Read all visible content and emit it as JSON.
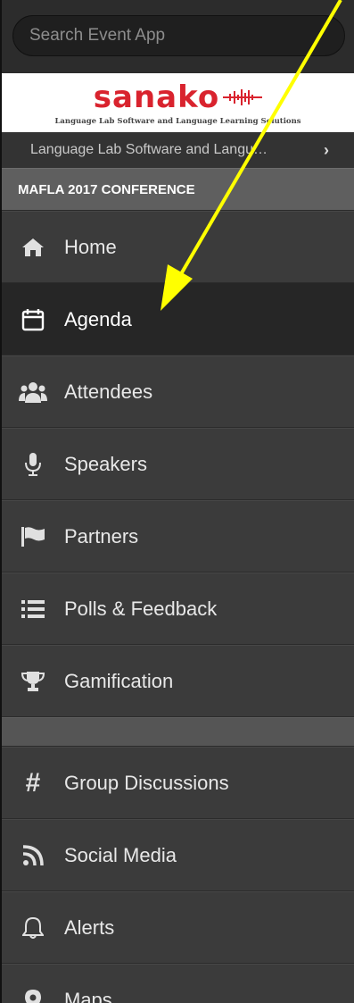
{
  "search": {
    "placeholder": "Search Event App"
  },
  "banner": {
    "logo_text": "sanako",
    "tagline": "Language Lab Software and Language Learning Solutions"
  },
  "sponsor": {
    "label": "Language Lab Software and Langu…"
  },
  "section": {
    "title": "MAFLA 2017 CONFERENCE"
  },
  "menu": [
    {
      "label": "Home",
      "icon": "home-icon"
    },
    {
      "label": "Agenda",
      "icon": "calendar-icon",
      "active": true
    },
    {
      "label": "Attendees",
      "icon": "users-icon"
    },
    {
      "label": "Speakers",
      "icon": "microphone-icon"
    },
    {
      "label": "Partners",
      "icon": "flag-icon"
    },
    {
      "label": "Polls & Feedback",
      "icon": "list-icon"
    },
    {
      "label": "Gamification",
      "icon": "trophy-icon"
    }
  ],
  "menu2": [
    {
      "label": "Group Discussions",
      "icon": "hashtag-icon"
    },
    {
      "label": "Social Media",
      "icon": "rss-icon"
    },
    {
      "label": "Alerts",
      "icon": "bell-icon"
    },
    {
      "label": "Maps",
      "icon": "map-marker-icon"
    }
  ],
  "colors": {
    "brand": "#d9232e",
    "annotation_arrow": "#ffff00",
    "active_bg": "#262626"
  }
}
